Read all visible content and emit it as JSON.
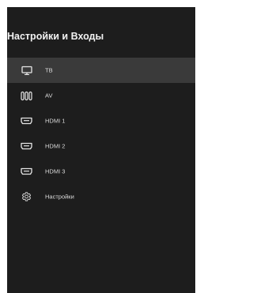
{
  "header": {
    "title": "Настройки и Входы"
  },
  "colors": {
    "panel_background": "#1d1d1d",
    "selected_background": "#3a3a3a",
    "text": "#dcdcdc"
  },
  "menu": {
    "selected_index": 0,
    "items": [
      {
        "label": "ТВ",
        "icon": "monitor-icon"
      },
      {
        "label": "AV",
        "icon": "av-connector-icon"
      },
      {
        "label": "HDMI 1",
        "icon": "hdmi-port-icon"
      },
      {
        "label": "HDMI 2",
        "icon": "hdmi-port-icon"
      },
      {
        "label": "HDMI 3",
        "icon": "hdmi-port-icon"
      },
      {
        "label": "Настройки",
        "icon": "gear-icon"
      }
    ]
  }
}
